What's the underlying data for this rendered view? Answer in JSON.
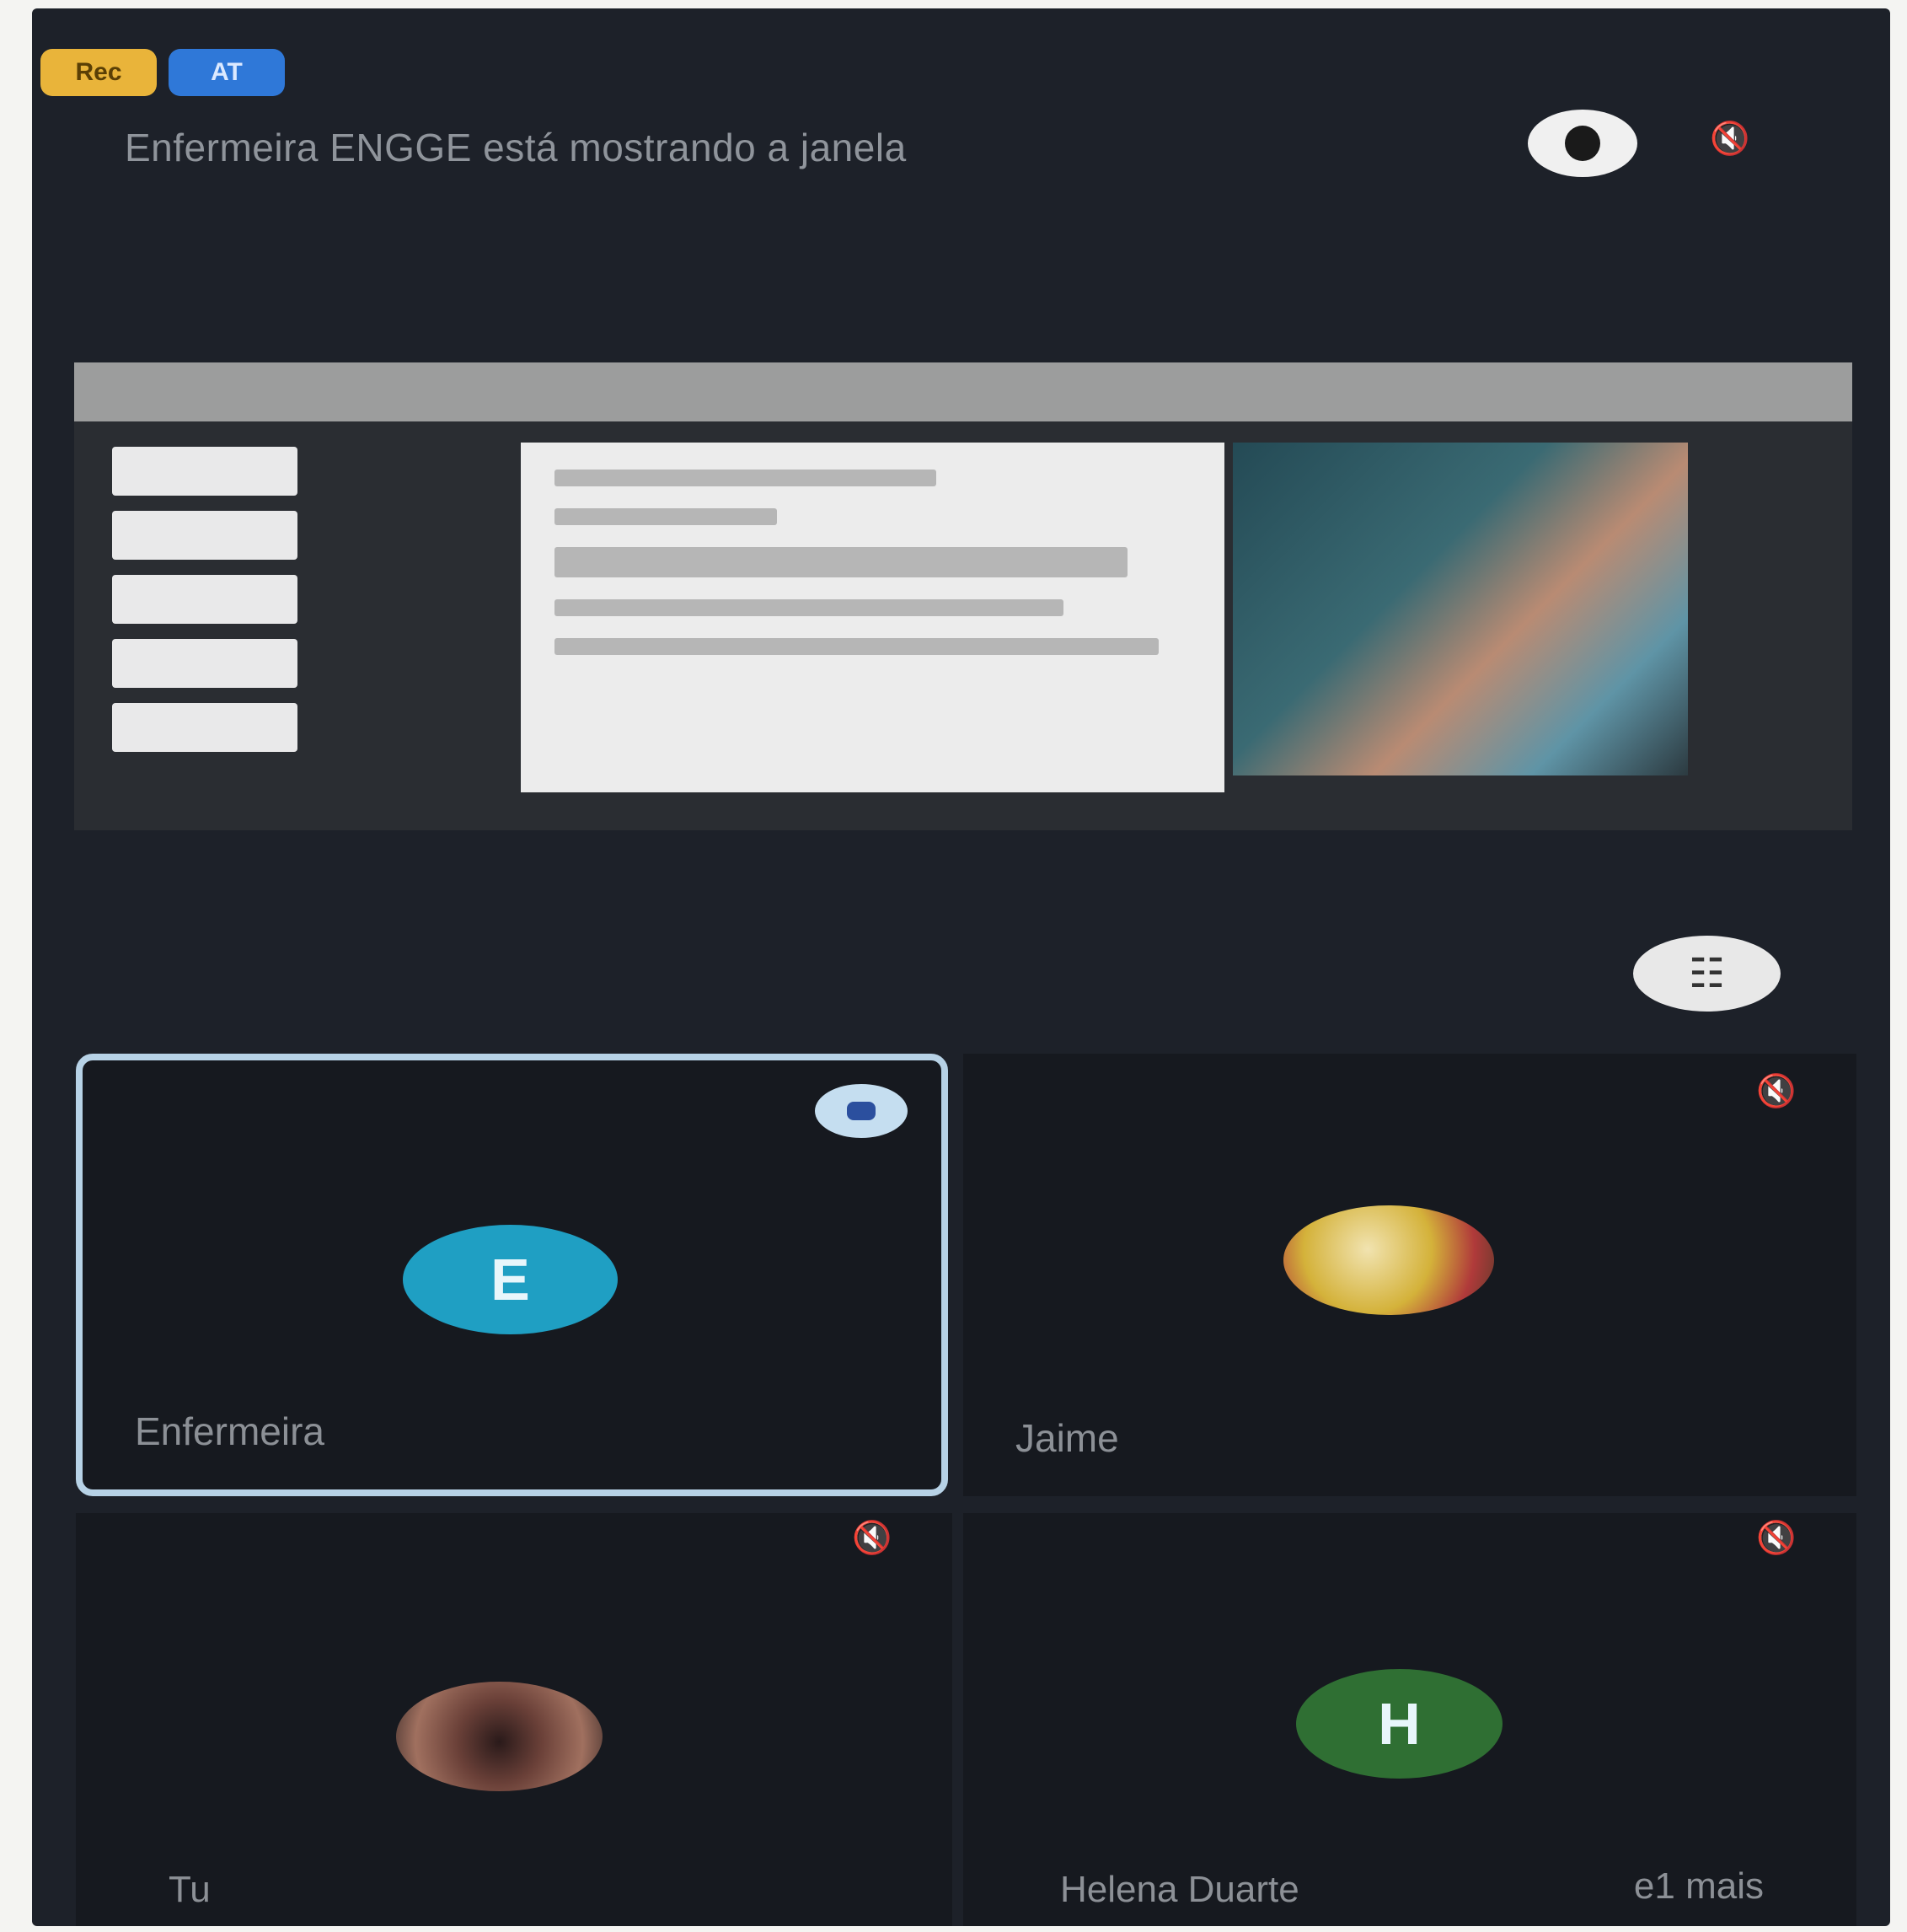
{
  "header": {
    "badges": [
      {
        "label": "Rec",
        "color": "#e9b43a"
      },
      {
        "label": "AT",
        "color": "#2f78d8"
      }
    ],
    "presenting_text": "Enfermeira ENGGE está mostrando a janela",
    "eye_icon": "eye-icon",
    "mic_icon": "mic-muted-icon"
  },
  "share": {
    "title": "Screen share preview"
  },
  "controls": {
    "grid_icon": "grid-icon"
  },
  "participants": [
    {
      "name": "Enfermeira",
      "avatar_letter": "E",
      "avatar_color": "#1f9fc3",
      "speaking": true
    },
    {
      "name": "Jaime",
      "avatar_letter": "",
      "avatar_color": "#d4b23a",
      "speaking": false
    },
    {
      "name": "Tu",
      "avatar_letter": "",
      "avatar_color": "#8a5a4a",
      "speaking": false
    },
    {
      "name": "Helena Duarte",
      "avatar_letter": "H",
      "avatar_color": "#2f6f33",
      "speaking": false
    }
  ],
  "footer": {
    "more_label": "e1 mais"
  }
}
